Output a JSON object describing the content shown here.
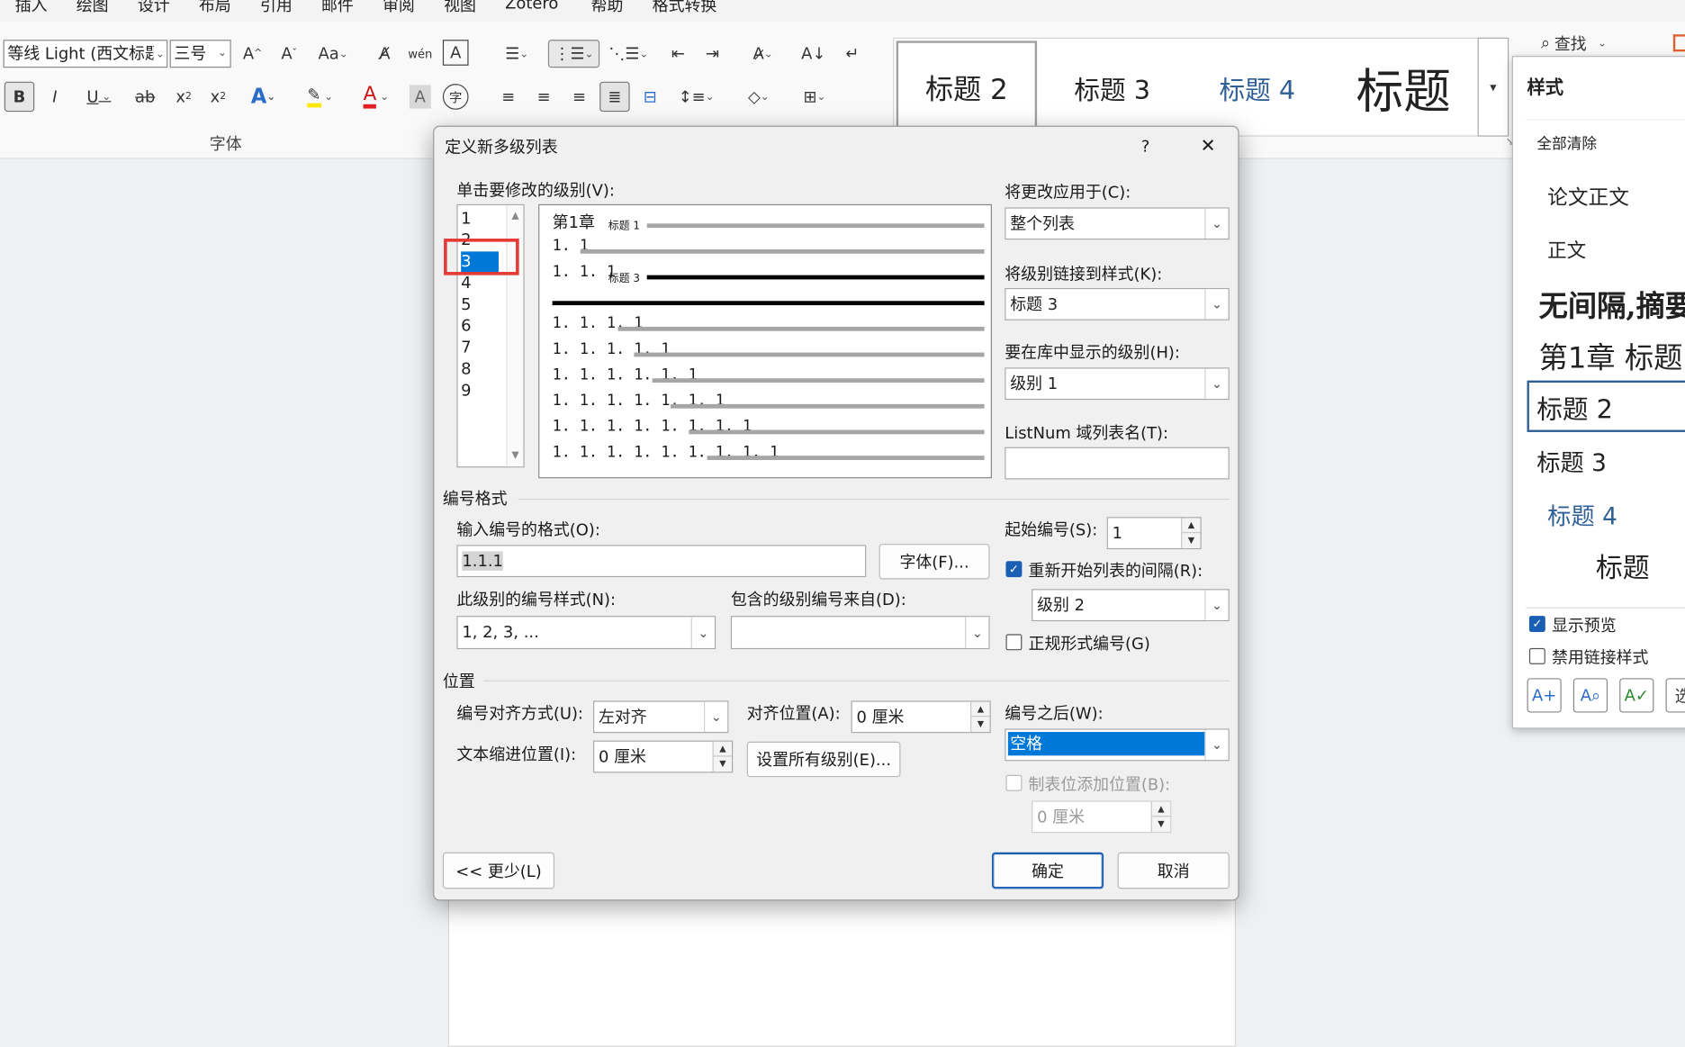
{
  "menubar": [
    "插入",
    "绘图",
    "设计",
    "布局",
    "引用",
    "邮件",
    "审阅",
    "视图",
    "Zotero",
    "帮助",
    "格式转换"
  ],
  "ribbon": {
    "font_name": "等线 Light (西文标题",
    "font_size": "三号",
    "font_group_label": "字体",
    "style_gallery": [
      "标题 2",
      "标题 3",
      "标题 4",
      "标题"
    ],
    "find_label": "查找"
  },
  "styles_pane": {
    "title": "样式",
    "items": [
      "全部清除",
      "论文正文",
      "正文",
      "无间隔,摘要",
      "第1章  标题",
      "标题 2",
      "标题 3",
      "标题 4",
      "标题"
    ],
    "show_preview_label": "显示预览",
    "disable_linked_label": "禁用链接样式"
  },
  "dialog": {
    "title": "定义新多级列表",
    "help": "?",
    "close": "✕",
    "level_list_label": "单击要修改的级别(V):",
    "levels": [
      "1",
      "2",
      "3",
      "4",
      "5",
      "6",
      "7",
      "8",
      "9"
    ],
    "selected_level": "3",
    "preview_lines": [
      {
        "text": "第1章",
        "tag": "标题 1"
      },
      {
        "text": "1. 1",
        "tag": ""
      },
      {
        "text": "1. 1. 1",
        "tag": "标题 3"
      },
      {
        "text": "",
        "tag": ""
      },
      {
        "text": "1. 1. 1. 1",
        "tag": ""
      },
      {
        "text": "1. 1. 1. 1. 1",
        "tag": ""
      },
      {
        "text": "1. 1. 1. 1. 1. 1",
        "tag": ""
      },
      {
        "text": "1. 1. 1. 1. 1. 1. 1",
        "tag": ""
      },
      {
        "text": "1. 1. 1. 1. 1. 1. 1. 1",
        "tag": ""
      },
      {
        "text": "1. 1. 1. 1. 1. 1. 1. 1. 1",
        "tag": ""
      }
    ],
    "apply_to_label": "将更改应用于(C):",
    "apply_to_value": "整个列表",
    "link_style_label": "将级别链接到样式(K):",
    "link_style_value": "标题 3",
    "gallery_level_label": "要在库中显示的级别(H):",
    "gallery_level_value": "级别 1",
    "listnum_label": "ListNum 域列表名(T):",
    "listnum_value": "",
    "numbering_format_section": "编号格式",
    "enter_format_label": "输入编号的格式(O):",
    "enter_format_value": "1.1.1",
    "font_button": "字体(F)...",
    "number_style_label": "此级别的编号样式(N):",
    "number_style_value": "1, 2, 3, ...",
    "include_level_label": "包含的级别编号来自(D):",
    "include_level_value": "",
    "start_at_label": "起始编号(S):",
    "start_at_value": "1",
    "restart_label": "重新开始列表的间隔(R):",
    "restart_checked": true,
    "restart_value": "级别 2",
    "legal_label": "正规形式编号(G)",
    "legal_checked": false,
    "position_section": "位置",
    "align_label": "编号对齐方式(U):",
    "align_value": "左对齐",
    "align_at_label": "对齐位置(A):",
    "align_at_value": "0 厘米",
    "indent_label": "文本缩进位置(I):",
    "indent_value": "0 厘米",
    "set_all_button": "设置所有级别(E)...",
    "follow_label": "编号之后(W):",
    "follow_value": "空格",
    "tab_stop_label": "制表位添加位置(B):",
    "tab_stop_checked": false,
    "tab_stop_value": "0 厘米",
    "less_button": "<< 更少(L)",
    "ok_button": "确定",
    "cancel_button": "取消"
  },
  "colors": {
    "accent": "#1a5fb4",
    "highlight": "#0078d7",
    "annotation_red": "#e53935"
  }
}
